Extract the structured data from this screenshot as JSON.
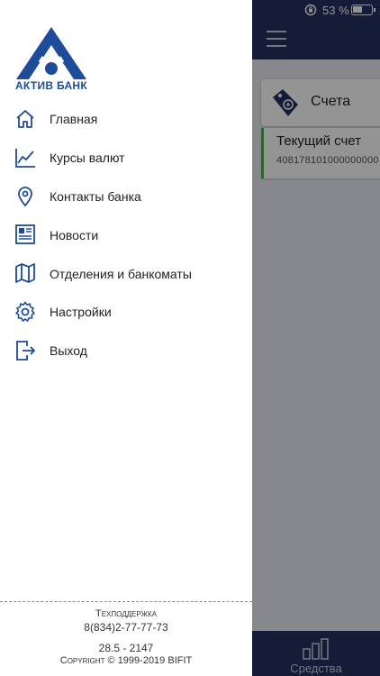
{
  "status_bar": {
    "battery_text": "53 %",
    "battery_level": 0.53
  },
  "background": {
    "accounts_title": "Счета",
    "account_name": "Текущий счет",
    "account_number": "408178101000000000",
    "bottom_tab": "Средства"
  },
  "drawer": {
    "logo_text": "АКТИВ БАНК",
    "menu": [
      {
        "label": "Главная",
        "icon": "home-icon"
      },
      {
        "label": "Курсы валют",
        "icon": "chart-line-icon"
      },
      {
        "label": "Контакты банка",
        "icon": "location-pin-icon"
      },
      {
        "label": "Новости",
        "icon": "newspaper-icon"
      },
      {
        "label": "Отделения и банкоматы",
        "icon": "map-icon"
      },
      {
        "label": "Настройки",
        "icon": "gear-icon"
      },
      {
        "label": "Выход",
        "icon": "logout-icon"
      }
    ],
    "footer": {
      "support_label": "Техподдержка",
      "phone": "8(834)2-77-77-73",
      "version": "28.5 - 2147",
      "copyright": "Copyright © 1999-2019 BIFIT"
    }
  },
  "colors": {
    "accent": "#23315f",
    "icon_blue": "#1e4c9a",
    "account_marker": "#4caf50"
  }
}
